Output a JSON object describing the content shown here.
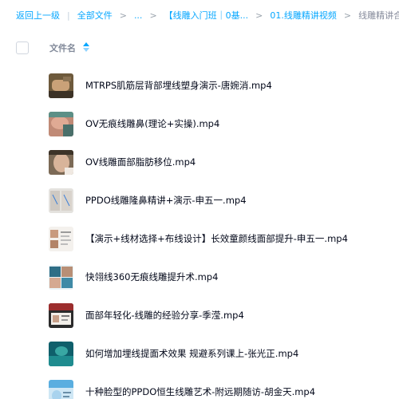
{
  "breadcrumb": {
    "back": "返回上一级",
    "all_files": "全部文件",
    "ellipsis": "...",
    "folder_1": "【线雕入门班｜0基...",
    "folder_2": "01.线雕精讲视频",
    "current": "线雕精讲合集"
  },
  "table": {
    "column_name": "文件名"
  },
  "files": [
    {
      "name": "MTRPS肌筋层背部埋线塑身演示-唐婉消.mp4",
      "thumb": "video-thumbnail-back-treatment"
    },
    {
      "name": "OV无痕线雕鼻(理论+实操).mp4",
      "thumb": "video-thumbnail-nose-procedure"
    },
    {
      "name": "OV线雕面部脂肪移位.mp4",
      "thumb": "video-thumbnail-face-treatment"
    },
    {
      "name": "PPDO线雕隆鼻精讲+演示-申五一.mp4",
      "thumb": "video-thumbnail-face-diagram"
    },
    {
      "name": "【演示+线材选择+布线设计】长效童颜线面部提升-申五一.mp4",
      "thumb": "video-thumbnail-slides"
    },
    {
      "name": "快翎线360无痕线雕提升术.mp4",
      "thumb": "video-thumbnail-face-collage"
    },
    {
      "name": "面部年轻化-线雕的经验分享-季滢.mp4",
      "thumb": "video-thumbnail-presentation"
    },
    {
      "name": "如何增加埋线提面术效果 规避系列课上-张光正.mp4",
      "thumb": "video-thumbnail-teal-slide"
    },
    {
      "name": "十种脸型的PPDO恒生线雕艺术-附远期随访-胡金天.mp4",
      "thumb": "video-thumbnail-blue-slide"
    }
  ]
}
